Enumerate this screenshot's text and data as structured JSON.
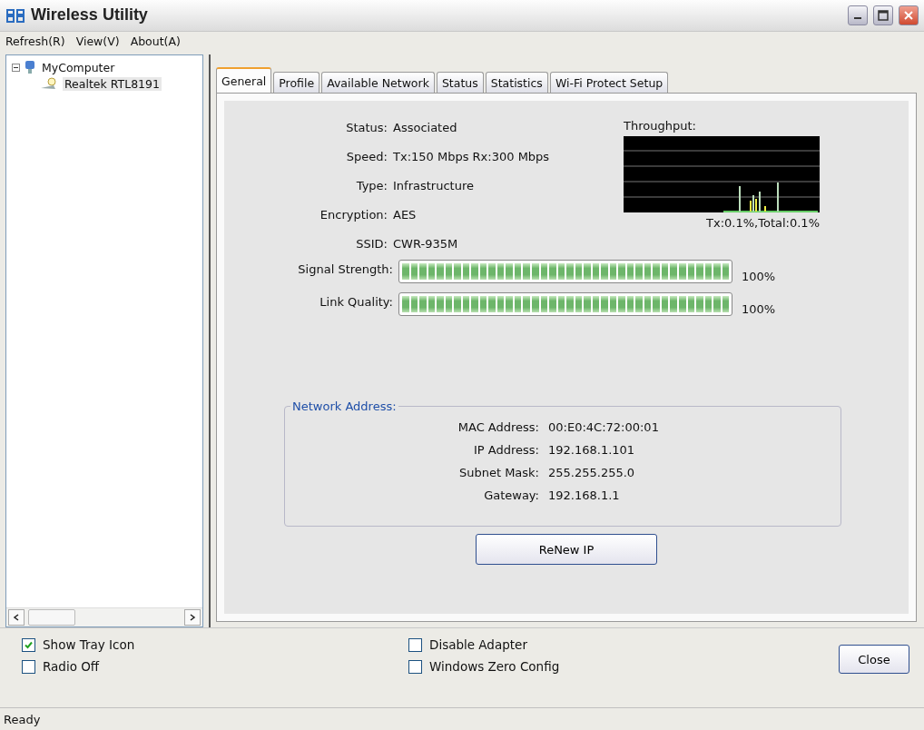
{
  "window": {
    "title": "Wireless Utility"
  },
  "menu": [
    "Refresh(R)",
    "View(V)",
    "About(A)"
  ],
  "tree": [
    {
      "label": "MyComputer",
      "expanded": true,
      "children": [
        {
          "label": "Realtek RTL8191",
          "selected": true
        }
      ]
    }
  ],
  "tabs": [
    {
      "label": "General",
      "selected": true
    },
    {
      "label": "Profile",
      "selected": false
    },
    {
      "label": "Available Network",
      "selected": false
    },
    {
      "label": "Status",
      "selected": false
    },
    {
      "label": "Statistics",
      "selected": false
    },
    {
      "label": "Wi-Fi Protect Setup",
      "selected": false
    }
  ],
  "general": {
    "fields": [
      {
        "label": "Status:",
        "value": "Associated"
      },
      {
        "label": "Speed:",
        "value": "Tx:150 Mbps Rx:300 Mbps"
      },
      {
        "label": "Type:",
        "value": "Infrastructure"
      },
      {
        "label": "Encryption:",
        "value": "AES"
      },
      {
        "label": "SSID:",
        "value": "CWR-935M"
      }
    ],
    "throughput": {
      "title": "Throughput:",
      "reading": "Tx:0.1%,Total:0.1%"
    },
    "meters": [
      {
        "label": "Signal Strength:",
        "level": 1,
        "reading": "100%"
      },
      {
        "label": "Link Quality:",
        "level": 1,
        "reading": "100%"
      }
    ],
    "network_address": {
      "title": "Network Address:",
      "fields": [
        {
          "label": "MAC Address:",
          "value": "00:E0:4C:72:00:01"
        },
        {
          "label": "IP Address:",
          "value": "192.168.1.101"
        },
        {
          "label": "Subnet Mask:",
          "value": "255.255.255.0"
        },
        {
          "label": "Gateway:",
          "value": "192.168.1.1"
        }
      ]
    },
    "renew_button": "ReNew IP"
  },
  "options": [
    [
      {
        "label": "Show Tray Icon",
        "checked": true
      },
      {
        "label": "Radio Off",
        "checked": false
      }
    ],
    [
      {
        "label": "Disable Adapter",
        "checked": false
      },
      {
        "label": "Windows Zero Config",
        "checked": false
      }
    ]
  ],
  "close_button": "Close",
  "status_bar": "Ready"
}
